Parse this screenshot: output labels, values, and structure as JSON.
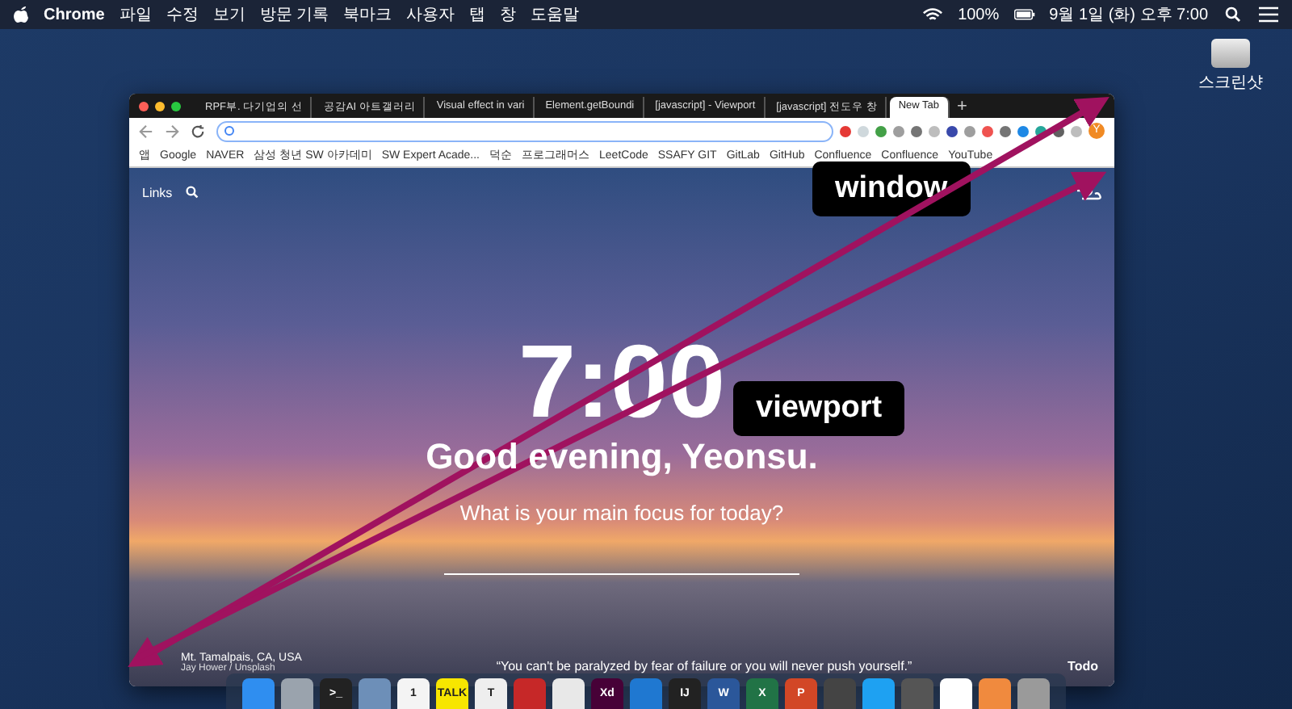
{
  "menu_bar": {
    "app": "Chrome",
    "items": [
      "파일",
      "수정",
      "보기",
      "방문 기록",
      "북마크",
      "사용자",
      "탭",
      "창",
      "도움말"
    ],
    "battery": "100%",
    "clock": "9월 1일 (화) 오후 7:00"
  },
  "desktop_icon": {
    "label": "스크린샷"
  },
  "browser": {
    "tabs": [
      {
        "title": "RPF부. 다기업의 선",
        "selected": false
      },
      {
        "title": "공감AI 아트갤러리",
        "selected": false
      },
      {
        "title": "Visual effect in vari",
        "selected": false
      },
      {
        "title": "Element.getBoundi",
        "selected": false
      },
      {
        "title": "[javascript] - Viewport",
        "selected": false
      },
      {
        "title": "[javascript] 전도우 창",
        "selected": false
      },
      {
        "title": "New Tab",
        "selected": true
      }
    ],
    "extensions": [
      {
        "color": "#e53935"
      },
      {
        "color": "#cfd8dc"
      },
      {
        "color": "#43a047"
      },
      {
        "color": "#9e9e9e"
      },
      {
        "color": "#757575"
      },
      {
        "color": "#bdbdbd"
      },
      {
        "color": "#3949ab"
      },
      {
        "color": "#9e9e9e"
      },
      {
        "color": "#ef5350"
      },
      {
        "color": "#757575"
      },
      {
        "color": "#1e88e5"
      },
      {
        "color": "#26a69a"
      },
      {
        "color": "#616161"
      },
      {
        "color": "#bdbdbd"
      }
    ],
    "new_tab": "+",
    "profile": "Y",
    "bookmarks": [
      "앱",
      "Google",
      "NAVER",
      "삼성 청년 SW 아카데미",
      "SW Expert Acade...",
      "덕순",
      "프로그래머스",
      "LeetCode",
      "SSAFY GIT",
      "GitLab",
      "GitHub",
      "Confluence",
      "Confluence",
      "YouTube"
    ],
    "page": {
      "links": "Links",
      "time": "7:00",
      "greeting": "Good evening, Yeonsu.",
      "focus_question": "What is your main focus for today?",
      "location": "Mt. Tamalpais, CA, USA",
      "credit": "Jay Hower / Unsplash",
      "quote": "“You can't be paralyzed by fear of failure or you will never push yourself.”",
      "todo": "Todo"
    }
  },
  "dock": [
    {
      "color": "#2f8ef0"
    },
    {
      "color": "#9aa3ad"
    },
    {
      "color": "#222222",
      "label": ">_"
    },
    {
      "color": "#6d8fb8"
    },
    {
      "color": "#f4f4f4",
      "label": "1"
    },
    {
      "color": "#f7e600",
      "label": "TALK"
    },
    {
      "color": "#eeeeee",
      "label": "T"
    },
    {
      "color": "#c62828"
    },
    {
      "color": "#e8e8e8"
    },
    {
      "color": "#470137",
      "label": "Xd"
    },
    {
      "color": "#1f78d1"
    },
    {
      "color": "#222222",
      "label": "IJ"
    },
    {
      "color": "#2b579a",
      "label": "W"
    },
    {
      "color": "#217346",
      "label": "X"
    },
    {
      "color": "#d24726",
      "label": "P"
    },
    {
      "color": "#444444"
    },
    {
      "color": "#1ea1f2"
    },
    {
      "color": "#555555"
    },
    {
      "color": "#ffffff"
    },
    {
      "color": "#f08a3e"
    },
    {
      "color": "#9a9a9a"
    }
  ],
  "annotations": [
    {
      "label": "window"
    },
    {
      "label": "viewport"
    }
  ]
}
